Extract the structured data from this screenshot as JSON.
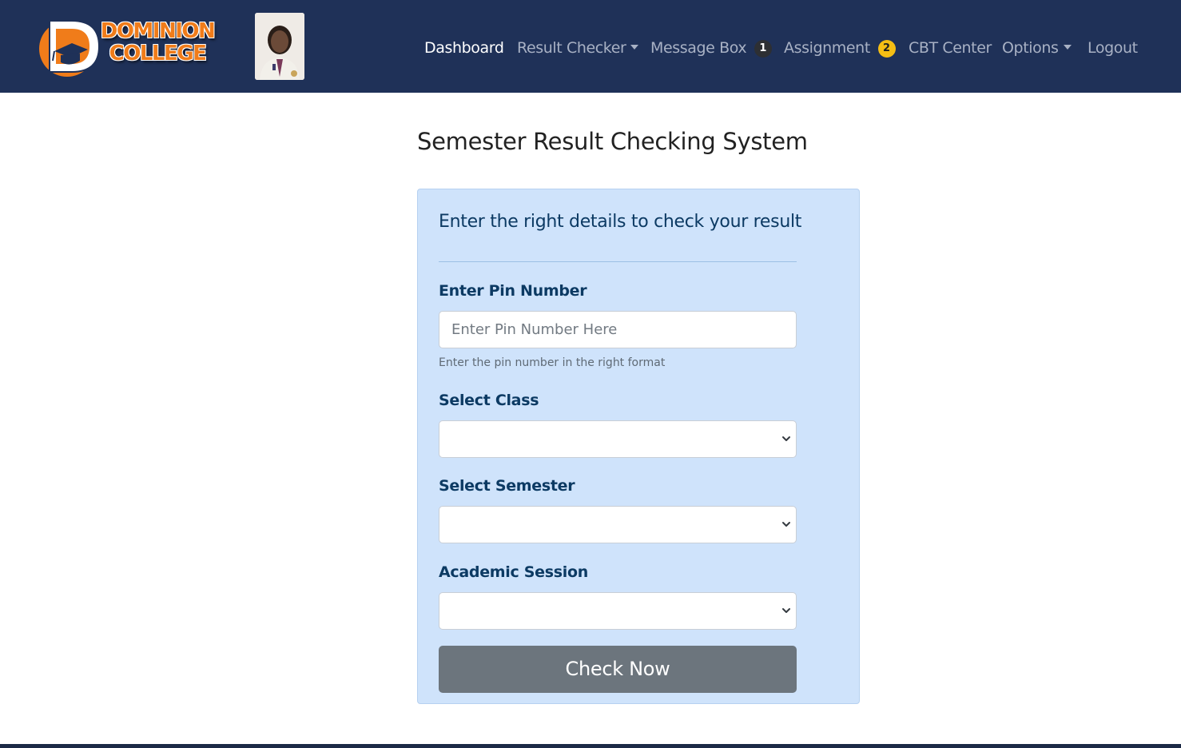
{
  "brand": {
    "line1": "DOMINION",
    "line2": "COLLEGE"
  },
  "nav": {
    "dashboard": "Dashboard",
    "result_checker": "Result Checker",
    "message_box": "Message Box",
    "message_count": "1",
    "assignment": "Assignment",
    "assignment_count": "2",
    "cbt_center": "CBT Center",
    "options": "Options",
    "logout": "Logout"
  },
  "page": {
    "title": "Semester Result Checking System"
  },
  "form": {
    "heading": "Enter the right details to check your result",
    "pin_label": "Enter Pin Number",
    "pin_placeholder": "Enter Pin Number Here",
    "pin_value": "",
    "pin_help": "Enter the pin number in the right format",
    "class_label": "Select Class",
    "class_value": "",
    "semester_label": "Select Semester",
    "semester_value": "",
    "session_label": "Academic Session",
    "session_value": "",
    "submit_label": "Check Now"
  },
  "colors": {
    "navbar": "#1f3158",
    "brand_orange": "#f07c1a",
    "card_bg": "#cfe3fb",
    "label_text": "#0c3a63",
    "button": "#6c757d",
    "badge_warning": "#f5be14"
  },
  "icons": [
    "logo-mark",
    "chevron-down-icon",
    "dropdown-caret-icon"
  ]
}
